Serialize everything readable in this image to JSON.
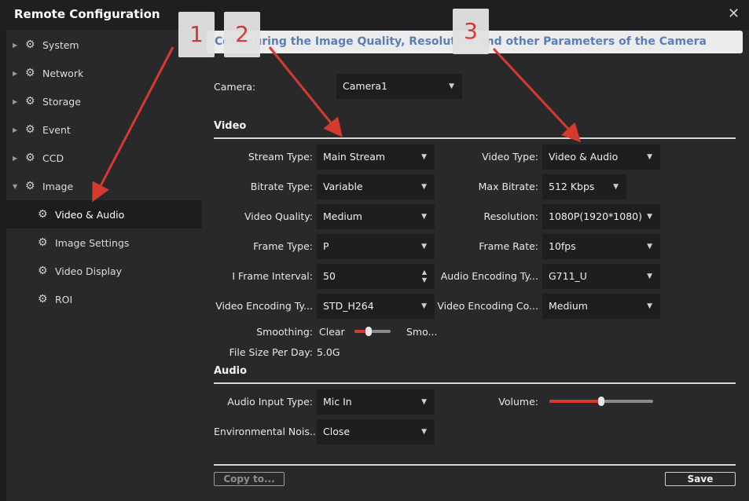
{
  "window": {
    "title": "Remote Configuration",
    "close_glyph": "✕"
  },
  "sidebar": {
    "items": [
      {
        "label": "System",
        "icon": "gear-icon"
      },
      {
        "label": "Network",
        "icon": "gear-icon"
      },
      {
        "label": "Storage",
        "icon": "gear-icon"
      },
      {
        "label": "Event",
        "icon": "gear-icon"
      },
      {
        "label": "CCD",
        "icon": "gear-icon"
      },
      {
        "label": "Image",
        "icon": "gear-icon"
      }
    ],
    "subitems": [
      {
        "label": "Video & Audio"
      },
      {
        "label": "Image Settings"
      },
      {
        "label": "Video Display"
      },
      {
        "label": "ROI"
      }
    ]
  },
  "banner": "Configuring the Image Quality, Resolution and other Parameters of the Camera",
  "annotations": [
    "1",
    "2",
    "3"
  ],
  "camera": {
    "label": "Camera:",
    "value": "Camera1"
  },
  "video": {
    "section": "Video",
    "stream_type": {
      "label": "Stream Type:",
      "value": "Main Stream"
    },
    "bitrate_type": {
      "label": "Bitrate Type:",
      "value": "Variable"
    },
    "video_quality": {
      "label": "Video Quality:",
      "value": "Medium"
    },
    "frame_type": {
      "label": "Frame Type:",
      "value": "P"
    },
    "i_frame_interval": {
      "label": "I Frame Interval:",
      "value": "50"
    },
    "video_encoding_type": {
      "label": "Video Encoding Ty...",
      "value": "STD_H264"
    },
    "smoothing": {
      "label": "Smoothing:",
      "left": "Clear",
      "right": "Smo...",
      "level": 0.4
    },
    "file_size": {
      "label": "File Size Per Day:",
      "value": "5.0G"
    },
    "video_type": {
      "label": "Video Type:",
      "value": "Video & Audio"
    },
    "max_bitrate": {
      "label": "Max Bitrate:",
      "value": "512 Kbps"
    },
    "resolution": {
      "label": "Resolution:",
      "value": "1080P(1920*1080)"
    },
    "frame_rate": {
      "label": "Frame Rate:",
      "value": "10fps"
    },
    "audio_encoding_type": {
      "label": "Audio Encoding Ty...",
      "value": "G711_U"
    },
    "video_encoding_complexity": {
      "label": "Video Encoding Co...",
      "value": "Medium"
    }
  },
  "audio": {
    "section": "Audio",
    "audio_input_type": {
      "label": "Audio Input Type:",
      "value": "Mic In"
    },
    "environmental_noise": {
      "label": "Environmental Nois...",
      "value": "Close"
    },
    "volume": {
      "label": "Volume:",
      "level": 0.5
    }
  },
  "footer": {
    "copy_label": "Copy to...",
    "save_label": "Save"
  },
  "colors": {
    "accent": "#d63a2f",
    "banner_text": "#5b7fb5"
  }
}
